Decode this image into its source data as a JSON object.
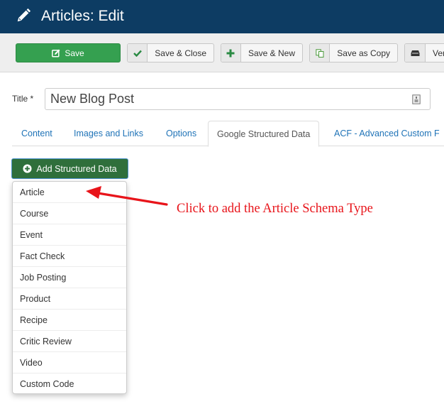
{
  "header": {
    "title": "Articles: Edit",
    "icon": "pencil-icon",
    "background_color": "#0d3c63"
  },
  "toolbar": {
    "save": {
      "label": "Save",
      "icon": "edit-icon"
    },
    "save_close": {
      "label": "Save & Close",
      "icon": "check-icon"
    },
    "save_new": {
      "label": "Save & New",
      "icon": "plus-icon"
    },
    "save_copy": {
      "label": "Save as Copy",
      "icon": "copy-icon"
    },
    "versions": {
      "label": "Vers",
      "icon": "archive-icon"
    },
    "save_color": "#35a050"
  },
  "form": {
    "title_label": "Title *",
    "title_value": "New Blog Post"
  },
  "tabs": [
    {
      "label": "Content",
      "active": false
    },
    {
      "label": "Images and Links",
      "active": false
    },
    {
      "label": "Options",
      "active": false
    },
    {
      "label": "Google Structured Data",
      "active": true
    },
    {
      "label": "ACF - Advanced Custom F",
      "active": false
    }
  ],
  "structured_data": {
    "add_button_label": "Add Structured Data",
    "add_button_color": "#2f6f3b",
    "menu_items": [
      "Article",
      "Course",
      "Event",
      "Fact Check",
      "Job Posting",
      "Product",
      "Recipe",
      "Critic Review",
      "Video",
      "Custom Code"
    ]
  },
  "annotation": {
    "text": "Click to add the Article Schema Type",
    "color": "#e8141a"
  }
}
